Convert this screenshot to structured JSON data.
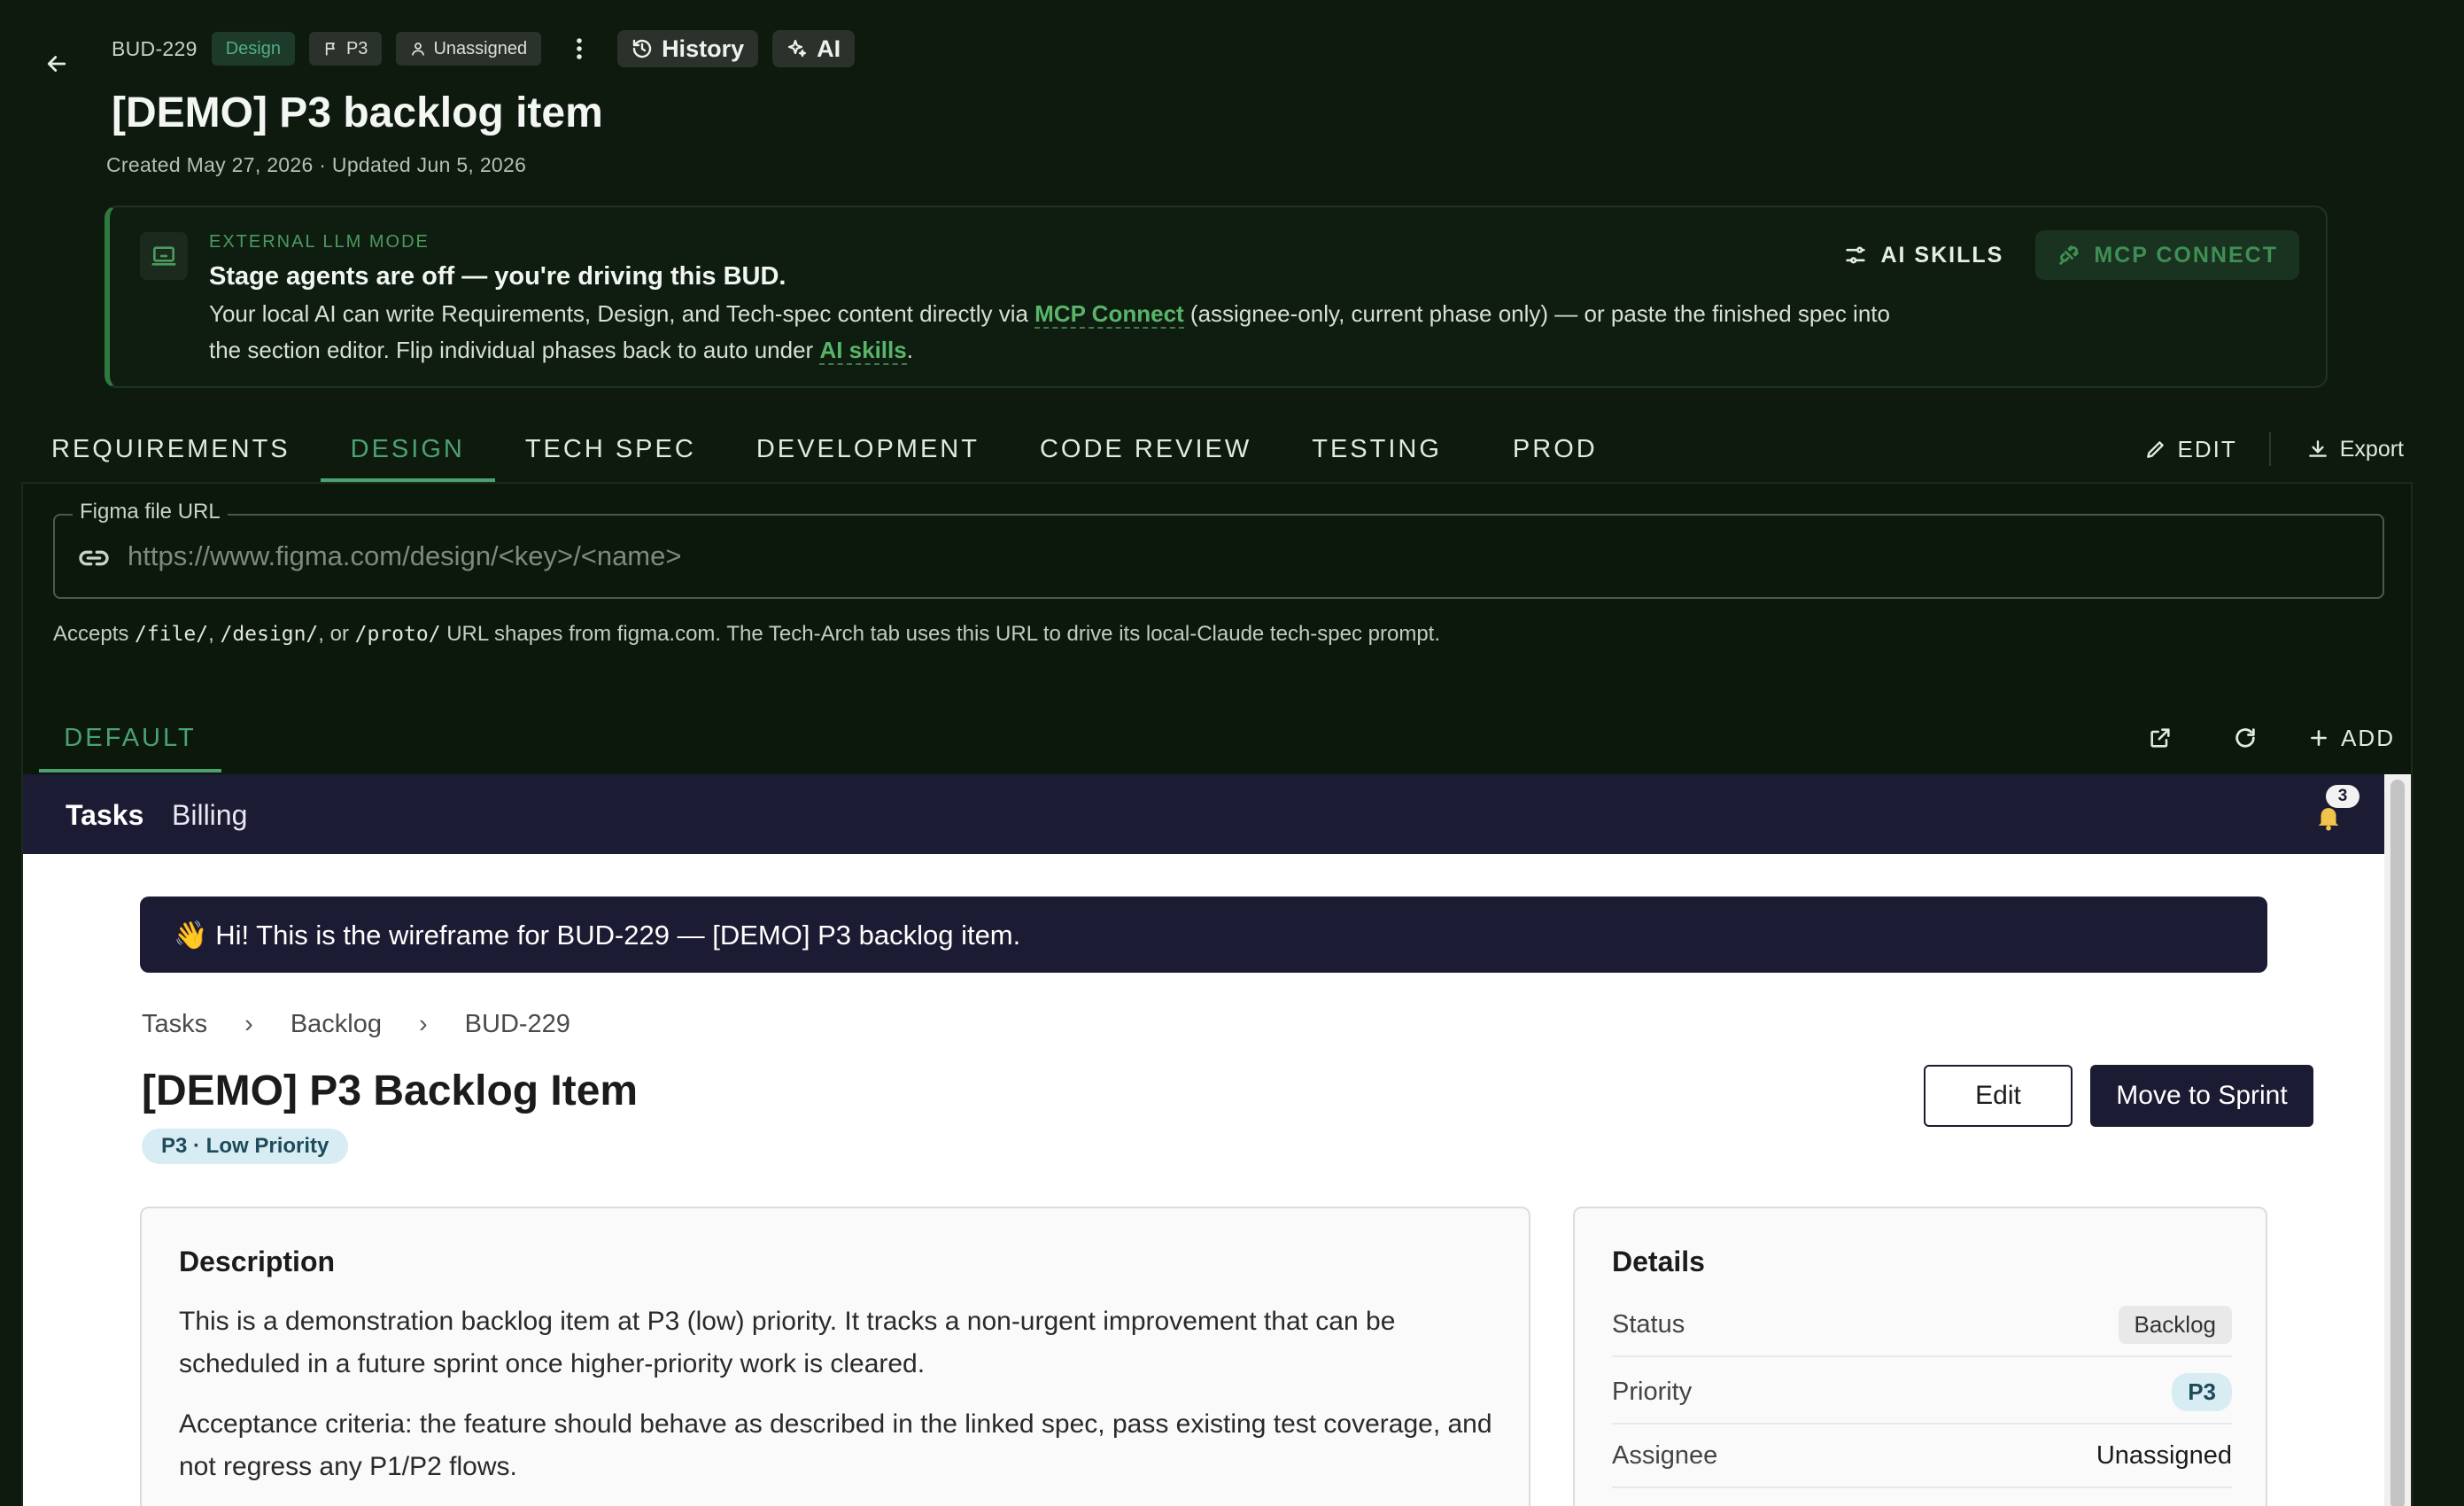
{
  "header": {
    "bud_id": "BUD-229",
    "phase_chip": "Design",
    "priority_chip": "P3",
    "assignee_chip": "Unassigned",
    "history_label": "History",
    "ai_label": "AI",
    "title": "[DEMO] P3 backlog item",
    "meta": "Created May 27, 2026 · Updated Jun 5, 2026"
  },
  "llm_banner": {
    "label": "EXTERNAL LLM MODE",
    "title": "Stage agents are off — you're driving this BUD.",
    "body_1": "Your local AI can write Requirements, Design, and Tech-spec content directly via ",
    "link_mcp": "MCP Connect",
    "body_2": " (assignee-only, current phase only) — or paste the finished spec into the section editor. Flip individual phases back to auto under ",
    "link_skills": "AI skills",
    "body_3": ".",
    "ai_skills_btn": "AI SKILLS",
    "mcp_btn": "MCP CONNECT"
  },
  "tabs": [
    {
      "label": "REQUIREMENTS"
    },
    {
      "label": "DESIGN"
    },
    {
      "label": "TECH SPEC"
    },
    {
      "label": "DEVELOPMENT"
    },
    {
      "label": "CODE REVIEW"
    },
    {
      "label": "TESTING"
    },
    {
      "label": "PROD"
    }
  ],
  "tab_actions": {
    "edit": "EDIT",
    "export": "Export"
  },
  "figma": {
    "legend": "Figma file URL",
    "placeholder": "https://www.figma.com/design/<key>/<name>",
    "value": "",
    "help_1": "Accepts ",
    "code_1": "/file/",
    "help_2": ", ",
    "code_2": "/design/",
    "help_3": ", or ",
    "code_3": "/proto/",
    "help_4": " URL shapes from figma.com. The Tech-Arch tab uses this URL to drive its local-Claude tech-spec prompt."
  },
  "subtabs": {
    "default": "DEFAULT",
    "add": "ADD"
  },
  "wireframe": {
    "nav": {
      "tasks": "Tasks",
      "billing": "Billing",
      "notification_count": "3"
    },
    "hello": "👋 Hi! This is the wireframe for BUD-229 — [DEMO] P3 backlog item.",
    "crumbs": [
      "Tasks",
      "Backlog",
      "BUD-229"
    ],
    "crumb_sep": "›",
    "title": "[DEMO] P3 Backlog Item",
    "tag": "P3 · Low Priority",
    "edit_btn": "Edit",
    "move_btn": "Move to Sprint",
    "description": {
      "heading": "Description",
      "p1": "This is a demonstration backlog item at P3 (low) priority. It tracks a non-urgent improvement that can be scheduled in a future sprint once higher-priority work is cleared.",
      "p2": "Acceptance criteria: the feature should behave as described in the linked spec, pass existing test coverage, and not regress any P1/P2 flows."
    },
    "details": {
      "heading": "Details",
      "rows": [
        {
          "label": "Status",
          "value": "Backlog"
        },
        {
          "label": "Priority",
          "value": "P3"
        },
        {
          "label": "Assignee",
          "value": "Unassigned"
        }
      ]
    }
  }
}
